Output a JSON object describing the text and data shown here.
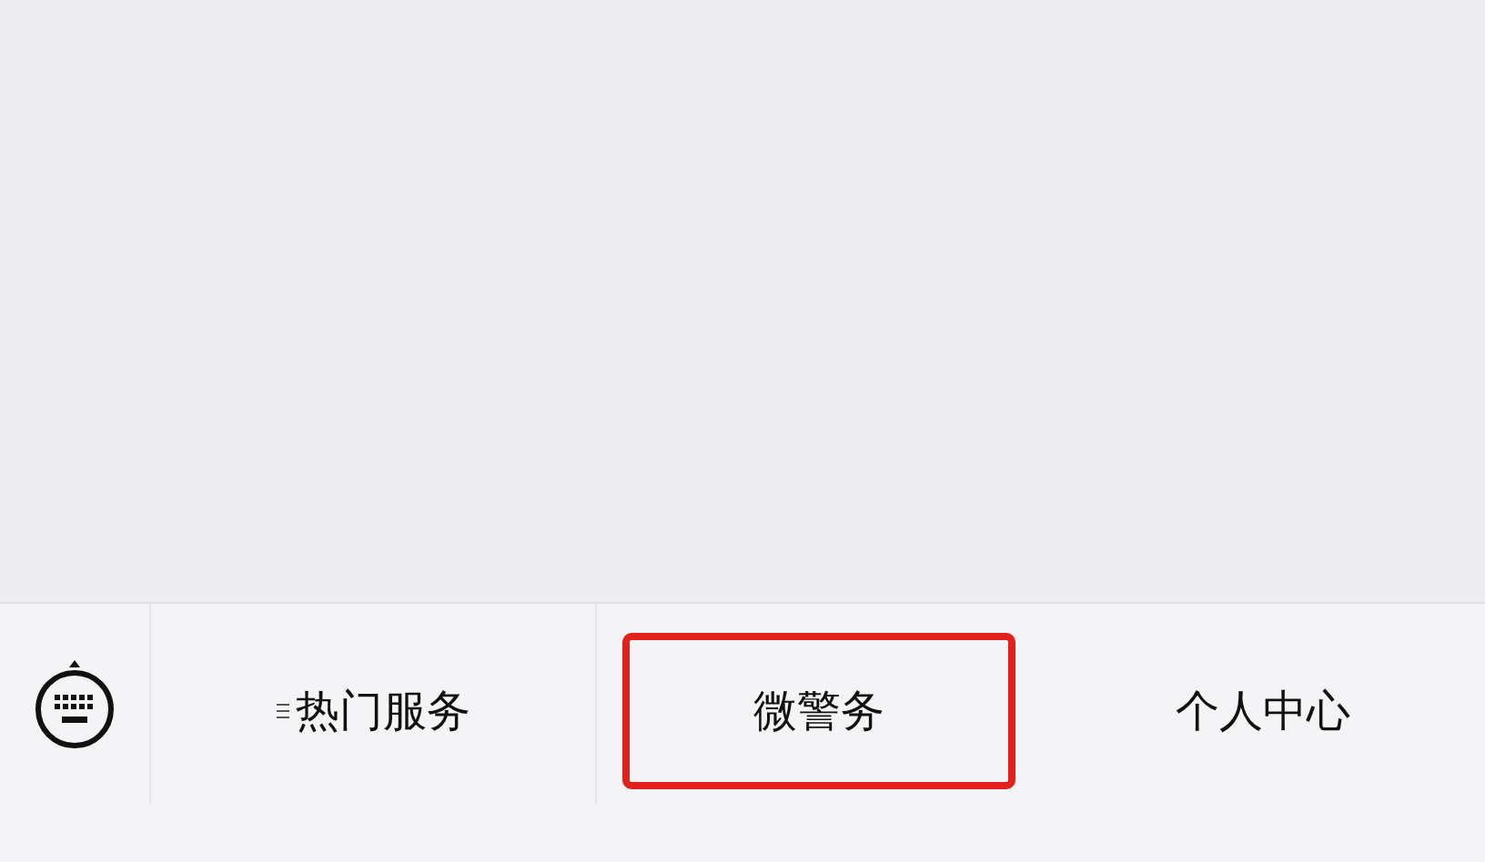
{
  "menu_bar": {
    "items": [
      {
        "label": "热门服务",
        "has_submenu": true,
        "highlighted": false
      },
      {
        "label": "微警务",
        "has_submenu": false,
        "highlighted": true
      },
      {
        "label": "个人中心",
        "has_submenu": false,
        "highlighted": false
      }
    ]
  }
}
